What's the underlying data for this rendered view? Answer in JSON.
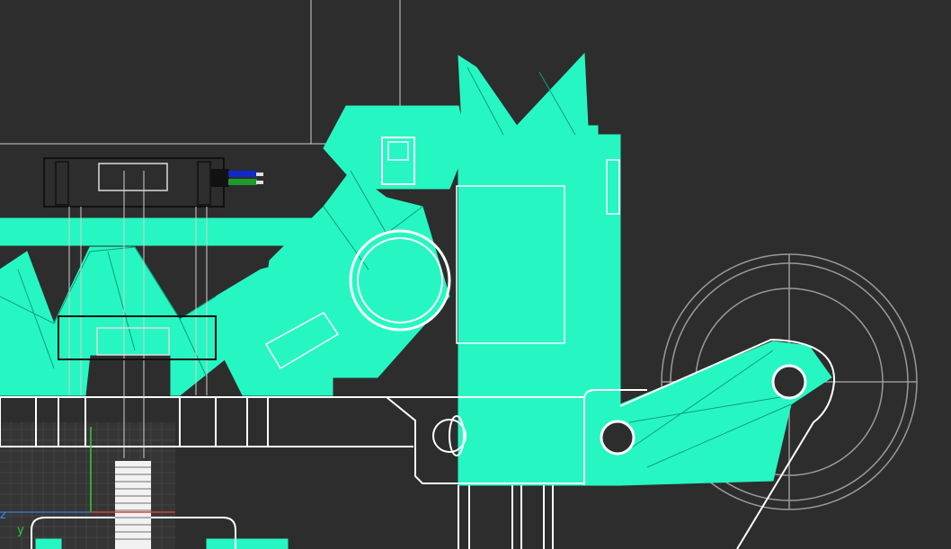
{
  "viewport": {
    "colors": {
      "background": "#2d2d2d",
      "mesh": "#26f7c2",
      "wireframe": "#ffffff",
      "wire_dim": "#bfbfbf",
      "grid": "#3c3c3c",
      "axis_x": "#d0463c",
      "axis_y": "#2fd12f",
      "axis_z": "#3a8fff"
    },
    "axis_labels": {
      "z": "z",
      "y": "y"
    }
  }
}
